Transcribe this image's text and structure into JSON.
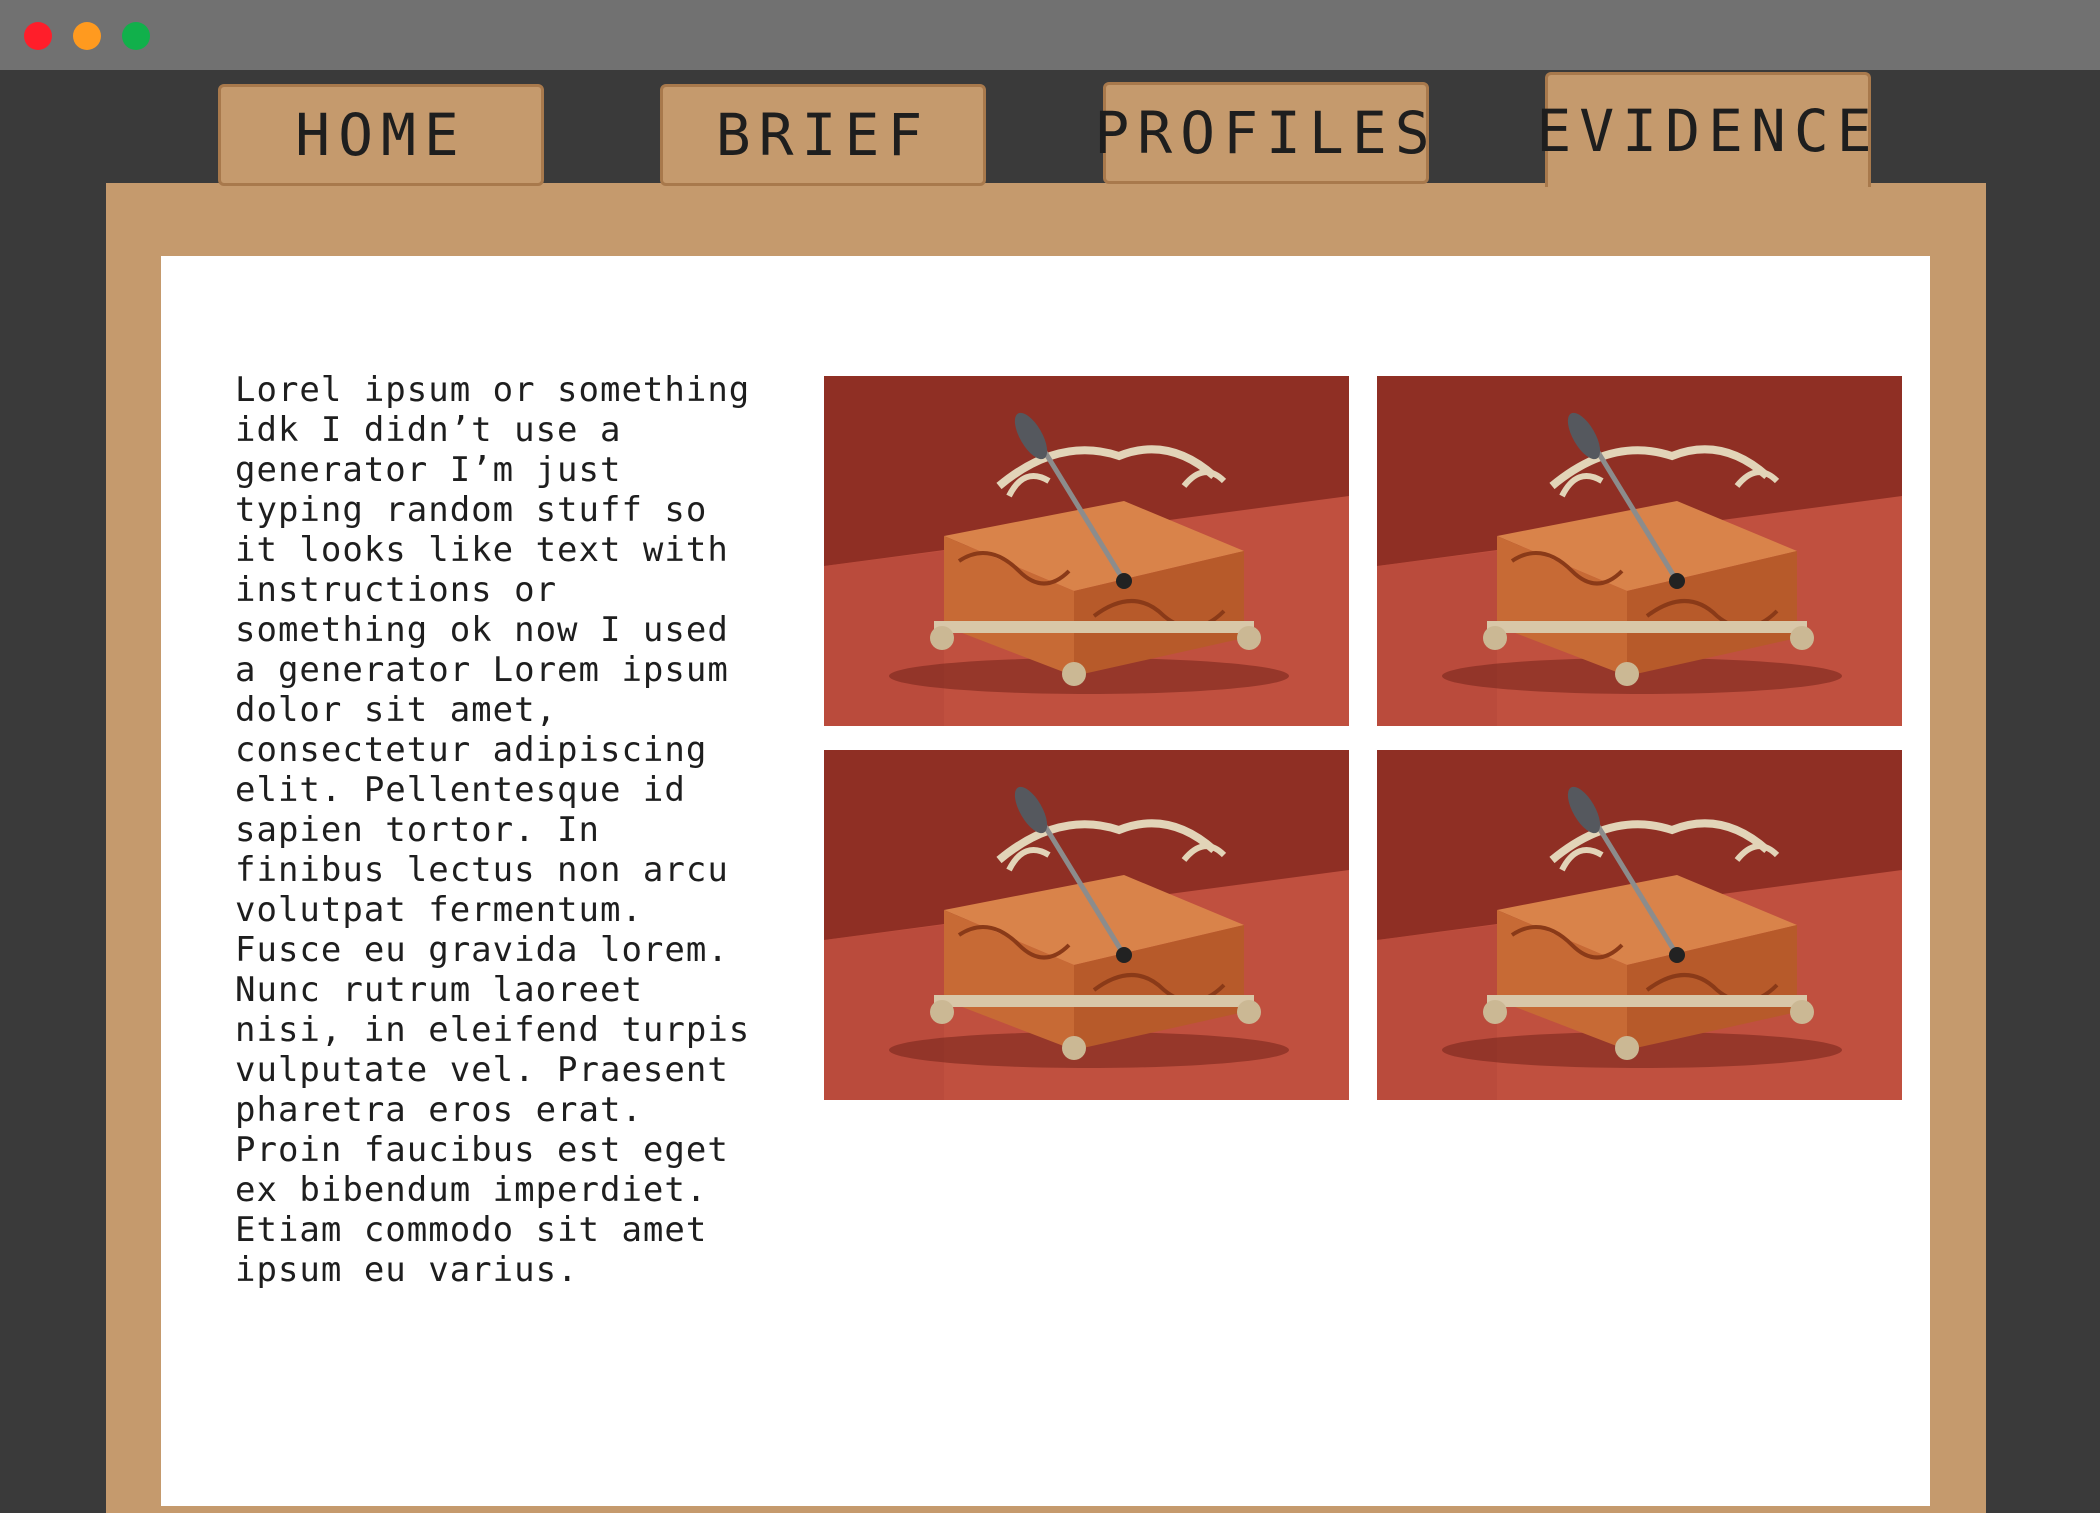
{
  "window": {
    "controls": [
      "close",
      "minimize",
      "maximize"
    ],
    "colors": {
      "close": "#ff1e2a",
      "minimize": "#ff9a1f",
      "maximize": "#11b04b"
    }
  },
  "nav": {
    "tabs": [
      {
        "label": "HOME",
        "active": false
      },
      {
        "label": "BRIEF",
        "active": false
      },
      {
        "label": "PROFILES",
        "active": false
      },
      {
        "label": "EVIDENCE",
        "active": true
      }
    ]
  },
  "content": {
    "text": "Lorel ipsum or something\nidk I didn’t use a\ngenerator I’m just\ntyping random stuff so\nit looks like text with\ninstructions or\nsomething ok now I used\na generator Lorem ipsum\ndolor sit amet,\nconsectetur adipiscing\nelit. Pellentesque id\nsapien tortor. In\nfinibus lectus non arcu\nvolutpat fermentum.\nFusce eu gravida lorem.\nNunc rutrum laoreet\nnisi, in eleifend turpis\nvulputate vel. Praesent\npharetra eros erat.\nProin faucibus est eget\nex bibendum imperdiet.\nEtiam commodo sit amet\nipsum eu varius.",
    "images": [
      {
        "subject": "ornate-copper-casket-with-key"
      },
      {
        "subject": "ornate-copper-casket-with-key"
      },
      {
        "subject": "ornate-copper-casket-with-key"
      },
      {
        "subject": "ornate-copper-casket-with-key"
      }
    ]
  },
  "theme": {
    "accent": "#c59a6d",
    "background": "#3a3a3a",
    "titlebar": "#717171",
    "panel": "#ffffff"
  }
}
